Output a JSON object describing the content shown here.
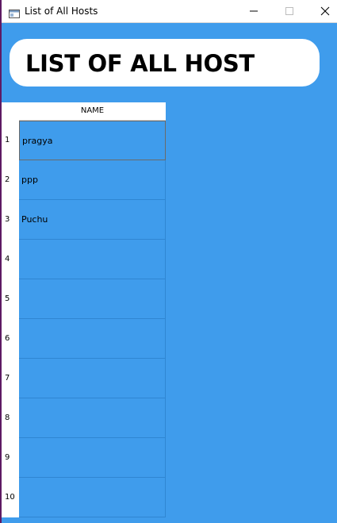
{
  "window": {
    "title": "List of All Hosts",
    "controls": [
      "minimize",
      "maximize",
      "close"
    ]
  },
  "header": {
    "title": "LIST OF ALL HOST"
  },
  "table": {
    "column_header": "NAME",
    "row_numbers": [
      "1",
      "2",
      "3",
      "4",
      "5",
      "6",
      "7",
      "8",
      "9",
      "10"
    ],
    "rows": [
      "pragya",
      "ppp",
      "Puchu",
      "",
      "",
      "",
      "",
      "",
      "",
      ""
    ],
    "selected_row": 1
  },
  "colors": {
    "background": "#3f9cec",
    "header_box": "#ffffff",
    "grid_line": "#2f86d2"
  }
}
